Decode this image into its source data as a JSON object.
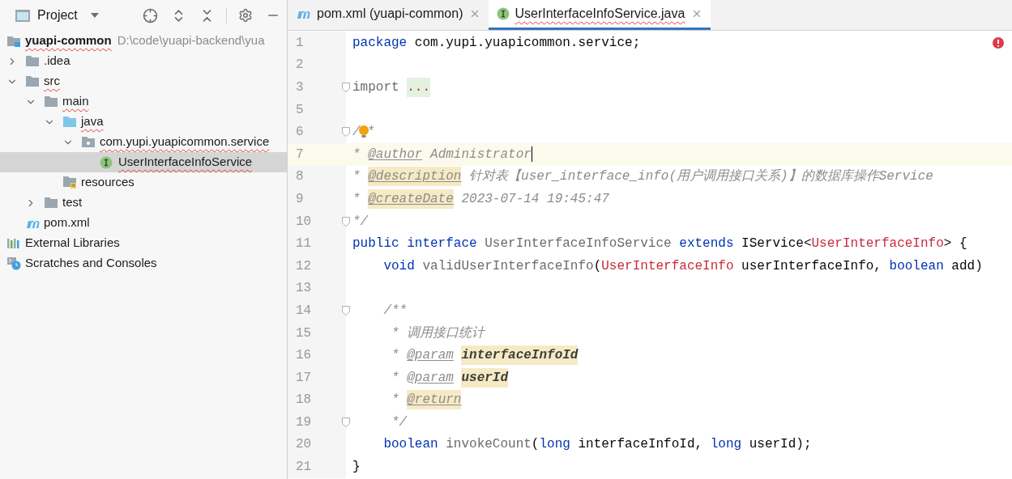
{
  "project_panel": {
    "title": "Project",
    "tree": [
      {
        "name": "yuapi-common",
        "path": "D:\\code\\yuapi-backend\\yua",
        "kind": "module",
        "spell_error": true,
        "selected": false,
        "children": [
          {
            "name": ".idea",
            "kind": "folder",
            "spell_error": false,
            "selected": false,
            "expanded": false
          },
          {
            "name": "src",
            "kind": "folder",
            "spell_error": true,
            "selected": false,
            "expanded": true,
            "children": [
              {
                "name": "main",
                "kind": "folder",
                "spell_error": true,
                "selected": false,
                "expanded": true,
                "children": [
                  {
                    "name": "java",
                    "kind": "source",
                    "spell_error": true,
                    "selected": false,
                    "expanded": true,
                    "children": [
                      {
                        "name": "com.yupi.yuapicommon.service",
                        "kind": "package",
                        "spell_error": true,
                        "selected": false,
                        "expanded": true,
                        "children": [
                          {
                            "name": "UserInterfaceInfoService",
                            "kind": "interface",
                            "spell_error": true,
                            "selected": true
                          }
                        ]
                      }
                    ]
                  },
                  {
                    "name": "resources",
                    "kind": "resources",
                    "spell_error": false,
                    "selected": false
                  }
                ]
              },
              {
                "name": "test",
                "kind": "folder",
                "spell_error": false,
                "selected": false,
                "expanded": false
              }
            ]
          },
          {
            "name": "pom.xml",
            "kind": "maven",
            "spell_error": false,
            "selected": false
          }
        ]
      },
      {
        "name": "External Libraries",
        "kind": "libraries",
        "spell_error": false,
        "selected": false
      },
      {
        "name": "Scratches and Consoles",
        "kind": "scratches",
        "spell_error": false,
        "selected": false
      }
    ]
  },
  "tabs": [
    {
      "label": "pom.xml (yuapi-common)",
      "kind": "maven",
      "selected": false,
      "spell_error": false
    },
    {
      "label": "UserInterfaceInfoService.java",
      "kind": "interface",
      "selected": true,
      "spell_error": true
    }
  ],
  "editor": {
    "lines": [
      {
        "number": "1",
        "current": false,
        "tokens": [
          {
            "kind": "kw",
            "text": "package"
          },
          {
            "kind": "txt",
            "text": " com.yupi.yuapicommon.service;"
          }
        ]
      },
      {
        "number": "2",
        "current": false
      },
      {
        "number": "3",
        "current": false,
        "fold": true,
        "tokens": [
          {
            "kind": "dim",
            "text": "import "
          },
          {
            "kind": "folded",
            "text": "..."
          }
        ]
      },
      {
        "number": "5",
        "current": false
      },
      {
        "number": "6",
        "current": false,
        "fold": true,
        "bulb": true,
        "tokens": [
          {
            "kind": "doc",
            "text": "/"
          },
          {
            "kind": "doc",
            "text": "*"
          }
        ]
      },
      {
        "number": "7",
        "current": true,
        "tokens": [
          {
            "kind": "doc",
            "text": "* "
          },
          {
            "kind": "tag",
            "text": "@author"
          },
          {
            "kind": "doc",
            "text": " Administrator"
          }
        ]
      },
      {
        "number": "8",
        "current": false,
        "tokens": [
          {
            "kind": "doc",
            "text": "* "
          },
          {
            "kind": "tagh",
            "text": "@description"
          },
          {
            "kind": "doc",
            "text": " 针对表【user_interface_info(用户调用接口关系)】的数据库操作Service"
          }
        ]
      },
      {
        "number": "9",
        "current": false,
        "tokens": [
          {
            "kind": "doc",
            "text": "* "
          },
          {
            "kind": "tagh",
            "text": "@createDate"
          },
          {
            "kind": "doc",
            "text": " 2023-07-14 19:45:47"
          }
        ]
      },
      {
        "number": "10",
        "current": false,
        "fold": true,
        "tokens": [
          {
            "kind": "doc",
            "text": "*/"
          }
        ]
      },
      {
        "number": "11",
        "current": false,
        "tokens": [
          {
            "kind": "kw",
            "text": "public interface "
          },
          {
            "kind": "dim",
            "text": "UserInterfaceInfoService "
          },
          {
            "kind": "kw",
            "text": "extends "
          },
          {
            "kind": "txt",
            "text": "IService<"
          },
          {
            "kind": "cls",
            "text": "UserInterfaceInfo"
          },
          {
            "kind": "txt",
            "text": "> {"
          }
        ]
      },
      {
        "number": "12",
        "current": false,
        "tokens": [
          {
            "kind": "kw",
            "text": "    void "
          },
          {
            "kind": "dim",
            "text": "validUserInterfaceInfo"
          },
          {
            "kind": "txt",
            "text": "("
          },
          {
            "kind": "cls",
            "text": "UserInterfaceInfo"
          },
          {
            "kind": "txt",
            "text": " userInterfaceInfo, "
          },
          {
            "kind": "kw",
            "text": "boolean"
          },
          {
            "kind": "txt",
            "text": " add)"
          }
        ]
      },
      {
        "number": "13",
        "current": false
      },
      {
        "number": "14",
        "current": false,
        "fold": true,
        "tokens": [
          {
            "kind": "doc",
            "text": "    /**"
          }
        ]
      },
      {
        "number": "15",
        "current": false,
        "tokens": [
          {
            "kind": "doc",
            "text": "     * 调用接口统计"
          }
        ]
      },
      {
        "number": "16",
        "current": false,
        "tokens": [
          {
            "kind": "doc",
            "text": "     * "
          },
          {
            "kind": "tag",
            "text": "@param"
          },
          {
            "kind": "param",
            "text": "interfaceInfoId"
          }
        ]
      },
      {
        "number": "17",
        "current": false,
        "tokens": [
          {
            "kind": "doc",
            "text": "     * "
          },
          {
            "kind": "tag",
            "text": "@param"
          },
          {
            "kind": "param",
            "text": "userId"
          }
        ]
      },
      {
        "number": "18",
        "current": false,
        "tokens": [
          {
            "kind": "doc",
            "text": "     * "
          },
          {
            "kind": "tagh",
            "text": "@return"
          }
        ]
      },
      {
        "number": "19",
        "current": false,
        "fold": true,
        "tokens": [
          {
            "kind": "doc",
            "text": "     */"
          }
        ]
      },
      {
        "number": "20",
        "current": false,
        "tokens": [
          {
            "kind": "kw",
            "text": "    boolean "
          },
          {
            "kind": "dim",
            "text": "invokeCount"
          },
          {
            "kind": "txt",
            "text": "("
          },
          {
            "kind": "kw",
            "text": "long"
          },
          {
            "kind": "txt",
            "text": " interfaceInfoId, "
          },
          {
            "kind": "kw",
            "text": "long"
          },
          {
            "kind": "txt",
            "text": " userId);"
          }
        ]
      },
      {
        "number": "21",
        "current": false,
        "tokens": [
          {
            "kind": "txt",
            "text": "}"
          }
        ]
      }
    ]
  }
}
